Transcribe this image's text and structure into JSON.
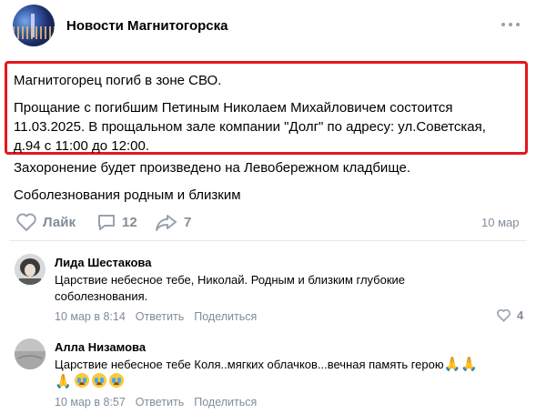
{
  "group": {
    "name": "Новости Магнитогорска",
    "avatar_icon": "city-night-avatar"
  },
  "post": {
    "line1": "Магнитогорец погиб в зоне СВО.",
    "para2_line1": "Прощание с погибшим Петиным Николаем Михайловичем состоится",
    "para2_line2": "11.03.2025. В прощальном зале компании \"Долг\" по адресу: ул.Советская,",
    "para2_line3": "д.94 с 11:00 до 12:00.",
    "burial": "Захоронение будет произведено на Левобережном кладбище.",
    "condolences": "Соболезнования родным и близким",
    "like_label": "Лайк",
    "comments_count": "12",
    "shares_count": "7",
    "date": "10 мар",
    "highlight_color": "#e3171d"
  },
  "comments": [
    {
      "author": "Лида Шестакова",
      "text_line1": "Царствие небесное тебе, Николай. Родным и близким глубокие",
      "text_line2": "соболезнования.",
      "date": "10 мар в 8:14",
      "reply_label": "Ответить",
      "share_label": "Поделиться",
      "likes": "4"
    },
    {
      "author": "Алла Низамова",
      "text_line1": "Царствие небесное тебе Коля..мягких облачков...вечная память герою",
      "date": "10 мар в 8:57",
      "reply_label": "Ответить",
      "share_label": "Поделиться"
    }
  ],
  "colors": {
    "muted": "#818c99",
    "icon": "#99a2ad"
  }
}
